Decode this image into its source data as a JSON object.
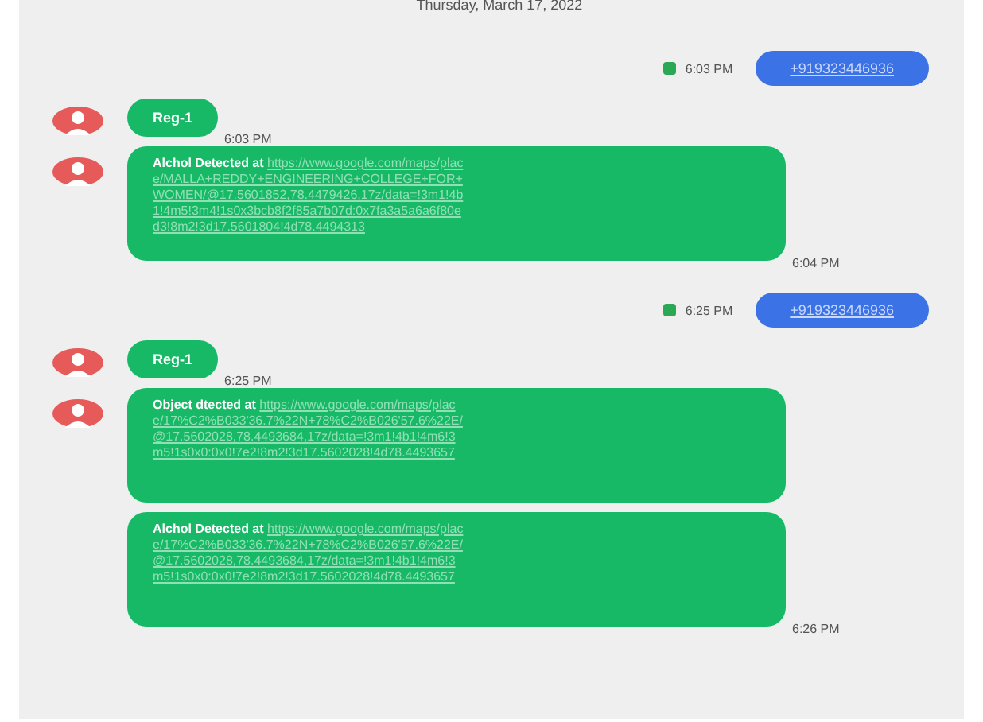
{
  "date_header": "Thursday, March 17, 2022",
  "messages": [
    {
      "kind": "outgoing",
      "status_icon": true,
      "time": "6:03 PM",
      "link": "+919323446936"
    },
    {
      "kind": "incoming",
      "avatar": true,
      "text": "Reg-1",
      "time": "6:03 PM"
    },
    {
      "kind": "incoming",
      "avatar": true,
      "text": "Alchol Detected at",
      "link": "https://www.google.com/maps/place/MALLA+REDDY+ENGINEERING+COLLEGE+FOR+WOMEN/@17.5601852,78.4479426,17z/data=!3m1!4b1!4m5!3m4!1s0x3bcb8f2f85a7b07d:0x7fa3a5a6a6f80ed3!8m2!3d17.5601804!4d78.4494313",
      "time": "6:04 PM"
    },
    {
      "kind": "outgoing",
      "status_icon": true,
      "time": "6:25 PM",
      "link": "+919323446936"
    },
    {
      "kind": "incoming",
      "avatar": true,
      "text": "Reg-1",
      "time": "6:25 PM"
    },
    {
      "kind": "incoming",
      "avatar": true,
      "text": "Object dtected at",
      "link": "https://www.google.com/maps/place/17%C2%B033'36.7%22N+78%C2%B026'57.6%22E/@17.5602028,78.4493684,17z/data=!3m1!4b1!4m6!3m5!1s0x0:0x0!7e2!8m2!3d17.5602028!4d78.4493657"
    },
    {
      "kind": "incoming",
      "avatar": false,
      "text": "Alchol Detected at",
      "link": "https://www.google.com/maps/place/17%C2%B033'36.7%22N+78%C2%B026'57.6%22E/@17.5602028,78.4493684,17z/data=!3m1!4b1!4m6!3m5!1s0x0:0x0!7e2!8m2!3d17.5602028!4d78.4493657",
      "time": "6:26 PM"
    }
  ]
}
